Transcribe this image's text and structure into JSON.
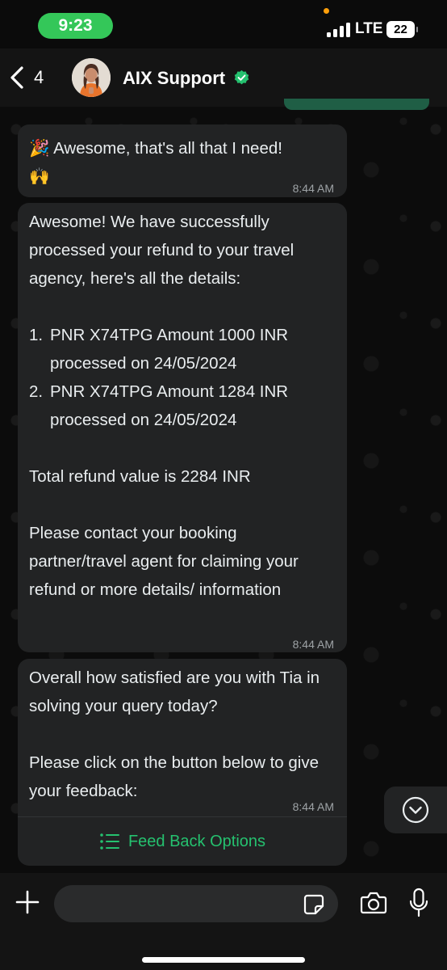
{
  "status_bar": {
    "time": "9:23",
    "network": "LTE",
    "battery": "22"
  },
  "header": {
    "back_count": "4",
    "contact_name": "AIX Support",
    "verified_icon": "verified-badge-icon"
  },
  "messages": [
    {
      "text": "🎉 Awesome, that's all that I need!\n🙌",
      "time": "8:44 AM"
    },
    {
      "intro": "Awesome! We have successfully processed your refund to your travel agency, here's all the details:",
      "items": [
        {
          "num": "1.",
          "text": "PNR X74TPG Amount 1000 INR processed on 24/05/2024"
        },
        {
          "num": "2.",
          "text": "PNR X74TPG Amount 1284 INR processed on 24/05/2024"
        }
      ],
      "total": "Total refund value is 2284 INR",
      "contact": "Please contact your booking partner/travel agent for claiming your refund or more details/ information",
      "time": "8:44 AM"
    },
    {
      "question": "Overall how satisfied are you with Tia in solving your query today?",
      "instruction": "Please click on the button below to give your feedback:",
      "time": "8:44 AM",
      "button_label": "Feed Back Options"
    }
  ],
  "input": {
    "placeholder": ""
  },
  "colors": {
    "accent_green": "#25c16f",
    "status_pill": "#34c759",
    "bubble_bg": "#222324"
  }
}
